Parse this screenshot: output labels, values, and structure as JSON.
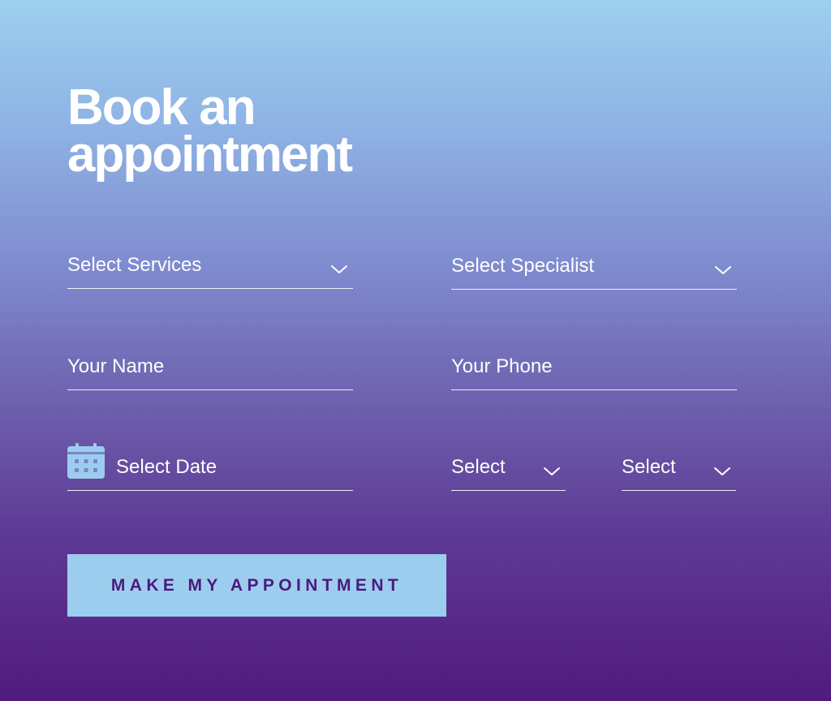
{
  "form": {
    "title_line1": "Book an",
    "title_line2": "appointment",
    "services": {
      "placeholder": "Select Services"
    },
    "specialist": {
      "placeholder": "Select Specialist"
    },
    "name": {
      "placeholder": "Your Name"
    },
    "phone": {
      "placeholder": "Your Phone"
    },
    "date": {
      "placeholder": "Select Date",
      "icon": "calendar-icon"
    },
    "time_select_1": {
      "placeholder": "Select"
    },
    "time_select_2": {
      "placeholder": "Select"
    },
    "submit_label": "MAKE MY APPOINTMENT"
  },
  "colors": {
    "gradient_top": "#9ccfef",
    "gradient_bottom": "#521a7e",
    "button_bg": "#9ccdee",
    "button_text": "#4b1a7e",
    "text": "#ffffff"
  }
}
